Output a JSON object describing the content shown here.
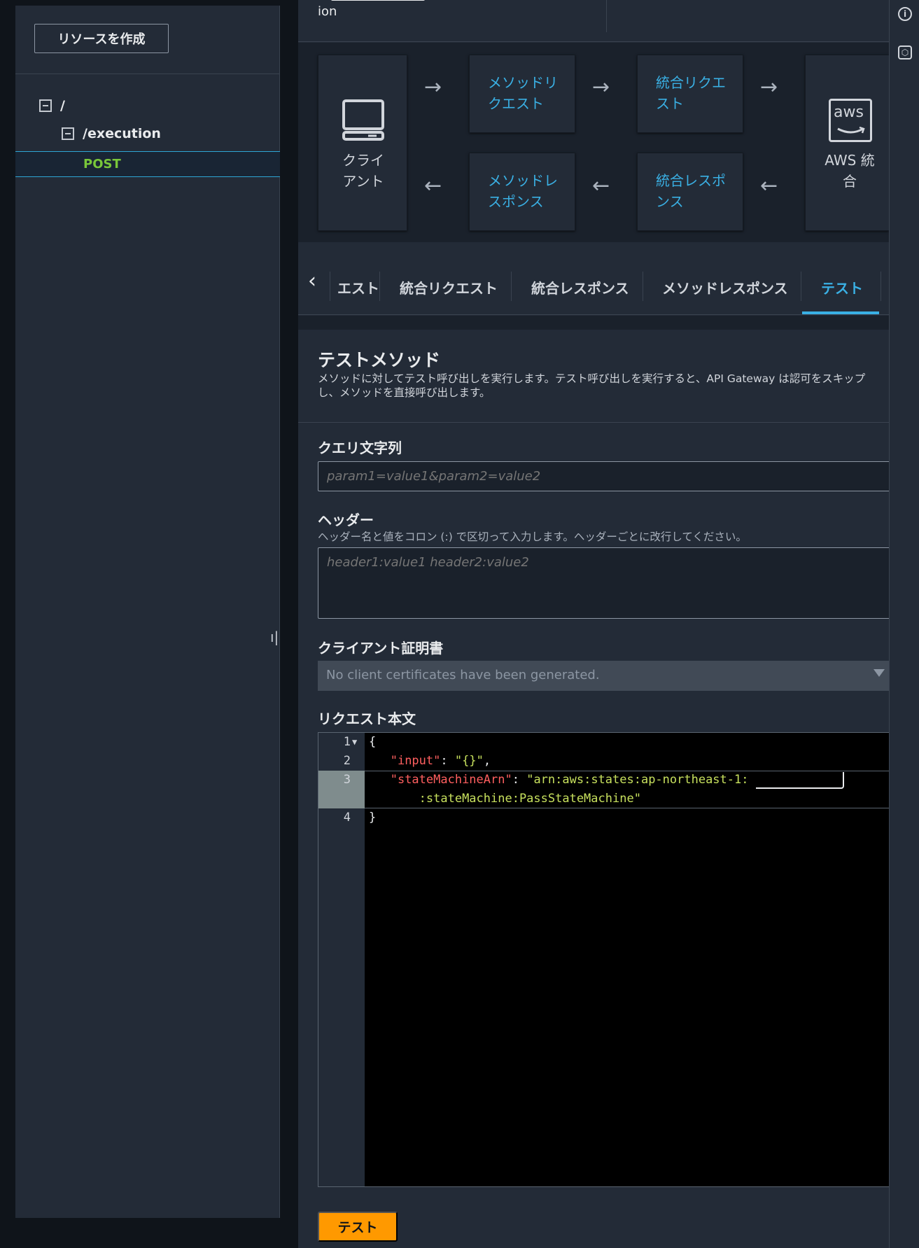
{
  "sidebar": {
    "create_button": "リソースを作成",
    "tree": {
      "root": "/",
      "child": "/execution",
      "method": "POST"
    },
    "resize_glyph": "ı|"
  },
  "top_strip": {
    "text": "ion"
  },
  "flow": {
    "client": "クライアント",
    "method_request": "メソッドリクエスト",
    "integration_request": "統合リクエスト",
    "aws_logo": "aws",
    "aws_integration": "AWS 統合",
    "method_response": "メソッドレスポンス",
    "integration_response": "統合レスポンス",
    "arrow_right": "→",
    "arrow_left": "←"
  },
  "tabs": {
    "chevron": "‹",
    "items": [
      "エスト",
      "統合リクエスト",
      "統合レスポンス",
      "メソッドレスポンス",
      "テスト"
    ],
    "active": "テスト"
  },
  "test_panel": {
    "title": "テストメソッド",
    "description": "メソッドに対してテスト呼び出しを実行します。テスト呼び出しを実行すると、API Gateway は認可をスキップし、メソッドを直接呼び出します。",
    "query": {
      "label": "クエリ文字列",
      "placeholder": "param1=value1&param2=value2"
    },
    "headers": {
      "label": "ヘッダー",
      "hint": "ヘッダー名と値をコロン (:) で区切って入力します。ヘッダーごとに改行してください。",
      "placeholder": "header1:value1 header2:value2"
    },
    "client_cert": {
      "label": "クライアント証明書",
      "value": "No client certificates have been generated."
    },
    "body": {
      "label": "リクエスト本文",
      "line_numbers": [
        "1",
        "2",
        "3",
        "4"
      ],
      "fold_marker": "▼",
      "open_brace": "{",
      "input_key": "\"input\"",
      "input_value": "\"{}\"",
      "arn_key": "\"stateMachineArn\"",
      "arn_value_part1": "\"arn:aws:states:ap-northeast-1:",
      "arn_value_part2": ":stateMachine:PassStateMachine\"",
      "close_brace": "}"
    },
    "submit": "テスト"
  },
  "rail": {
    "info_icon": "i",
    "settings_icon": "⬡"
  }
}
